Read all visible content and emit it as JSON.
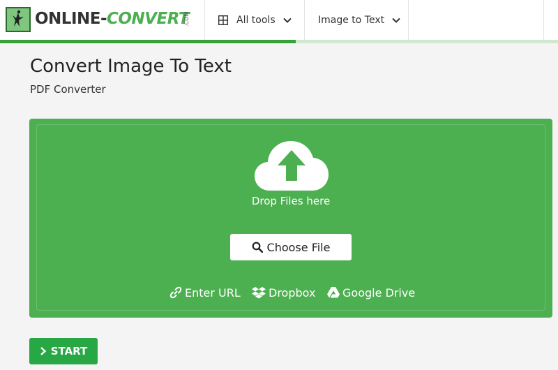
{
  "header": {
    "logo_text_main": "ONLINE-",
    "logo_text_accent": "CONVERT",
    "logo_text_suffix": ".COM",
    "nav": [
      {
        "label": "All tools",
        "icon": "grid-icon"
      },
      {
        "label": "Image to Text",
        "icon": ""
      }
    ],
    "progress_fraction": 0.53
  },
  "main": {
    "title": "Convert Image To Text",
    "subtitle": "PDF Converter",
    "dropzone": {
      "drop_label": "Drop Files here",
      "choose_label": "Choose File",
      "sources": [
        {
          "label": "Enter URL",
          "icon": "link-icon"
        },
        {
          "label": "Dropbox",
          "icon": "dropbox-icon"
        },
        {
          "label": "Google Drive",
          "icon": "google-drive-icon"
        }
      ]
    },
    "start_label": "START"
  },
  "colors": {
    "brand_green": "#4caf50",
    "start_green": "#28a745"
  }
}
